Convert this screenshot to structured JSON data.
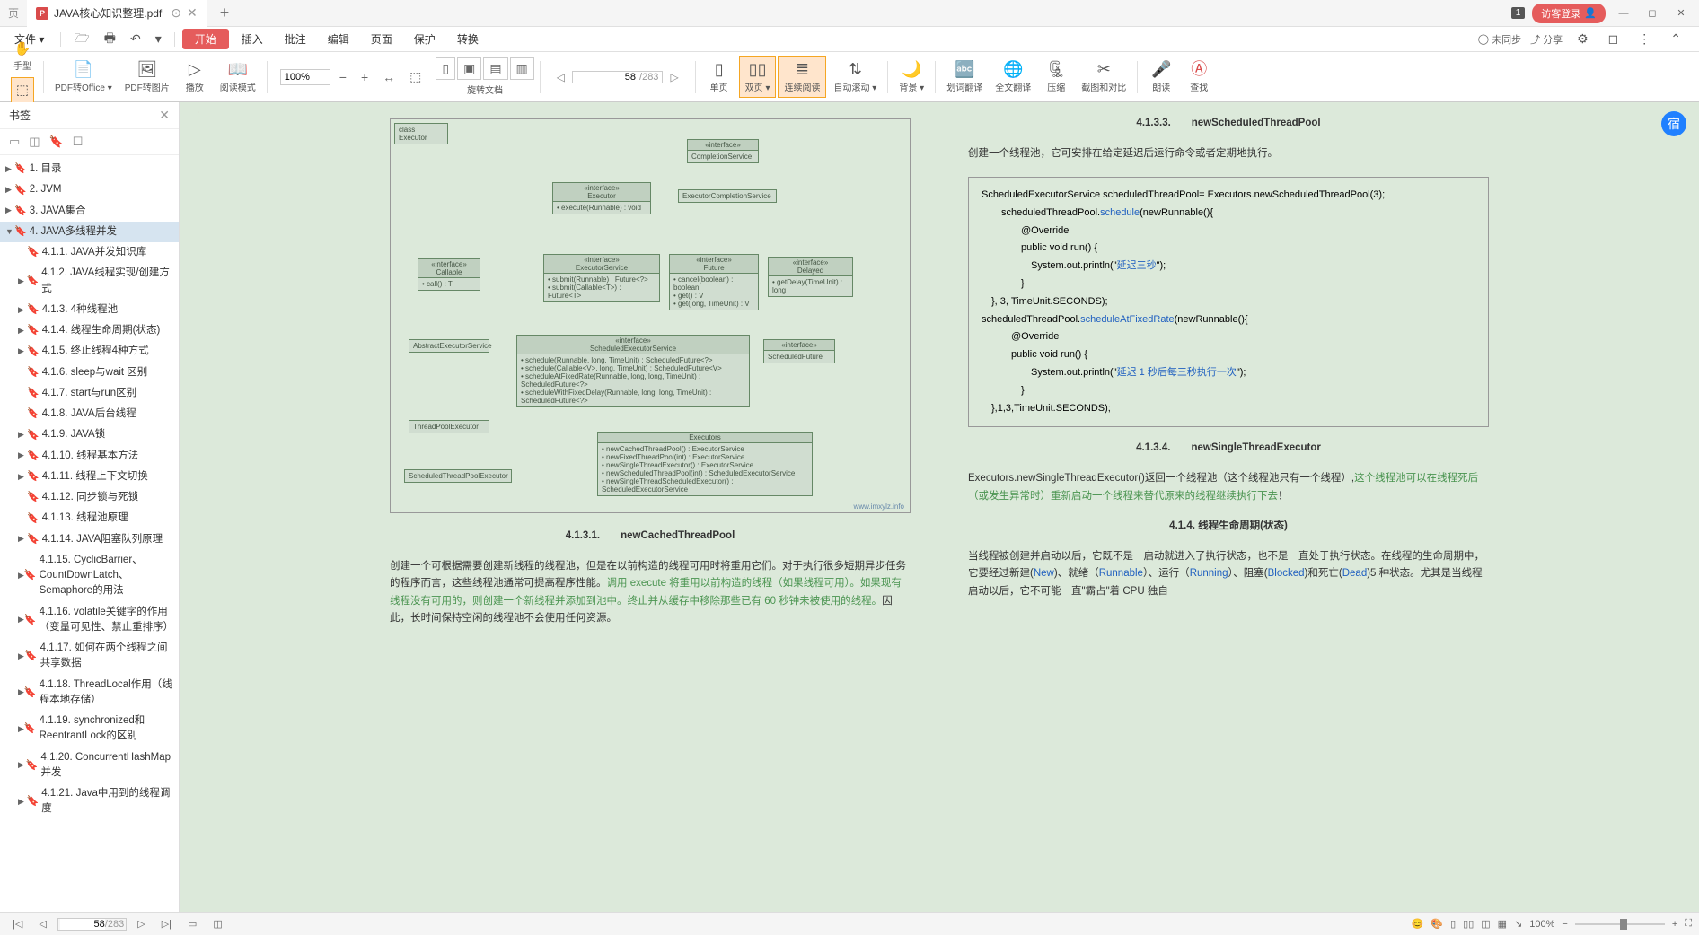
{
  "tab": {
    "icon": "P",
    "title": "JAVA核心知识整理.pdf",
    "modified": "⊙"
  },
  "titlebar": {
    "badge": "1",
    "login": "访客登录"
  },
  "menu": {
    "left_label": "页",
    "file": "文件 ▾",
    "start": "开始",
    "items": [
      "插入",
      "批注",
      "编辑",
      "页面",
      "保护",
      "转换"
    ],
    "unsync": "未同步",
    "share": "分享"
  },
  "left_tools": {
    "hand": "手型",
    "select": "选择"
  },
  "toolbar": {
    "pdf_office": "PDF转Office ▾",
    "pdf_image": "PDF转图片",
    "play": "播放",
    "read_mode": "阅读模式",
    "zoom": "100%",
    "rotate": "旋转文档",
    "page_current": "58",
    "page_total": "/283",
    "single": "单页",
    "double": "双页 ▾",
    "continuous": "连续阅读",
    "auto_scroll": "自动滚动 ▾",
    "bg": "背景 ▾",
    "translate_lookup": "划词翻译",
    "translate_full": "全文翻译",
    "compress": "压缩",
    "screenshot": "截图和对比",
    "read_aloud": "朗读",
    "find": "查找"
  },
  "bookmark": {
    "title": "书签",
    "tree": [
      {
        "level": 0,
        "expand": "▶",
        "text": "1. 目录"
      },
      {
        "level": 0,
        "expand": "▶",
        "text": "2. JVM"
      },
      {
        "level": 0,
        "expand": "▶",
        "text": "3. JAVA集合"
      },
      {
        "level": 0,
        "expand": "▼",
        "text": "4. JAVA多线程并发",
        "selected": true
      },
      {
        "level": 1,
        "expand": "",
        "text": "4.1.1. JAVA并发知识库"
      },
      {
        "level": 1,
        "expand": "▶",
        "text": "4.1.2. JAVA线程实现/创建方式"
      },
      {
        "level": 1,
        "expand": "▶",
        "text": "4.1.3. 4种线程池"
      },
      {
        "level": 1,
        "expand": "▶",
        "text": "4.1.4. 线程生命周期(状态)"
      },
      {
        "level": 1,
        "expand": "▶",
        "text": "4.1.5. 终止线程4种方式"
      },
      {
        "level": 1,
        "expand": "",
        "text": "4.1.6. sleep与wait 区别"
      },
      {
        "level": 1,
        "expand": "",
        "text": "4.1.7. start与run区别"
      },
      {
        "level": 1,
        "expand": "",
        "text": "4.1.8. JAVA后台线程"
      },
      {
        "level": 1,
        "expand": "▶",
        "text": "4.1.9. JAVA锁"
      },
      {
        "level": 1,
        "expand": "▶",
        "text": "4.1.10. 线程基本方法"
      },
      {
        "level": 1,
        "expand": "▶",
        "text": "4.1.11. 线程上下文切换"
      },
      {
        "level": 1,
        "expand": "",
        "text": "4.1.12. 同步锁与死锁"
      },
      {
        "level": 1,
        "expand": "",
        "text": "4.1.13. 线程池原理"
      },
      {
        "level": 1,
        "expand": "▶",
        "text": "4.1.14. JAVA阻塞队列原理"
      },
      {
        "level": 1,
        "expand": "▶",
        "text": "4.1.15. CyclicBarrier、CountDownLatch、Semaphore的用法"
      },
      {
        "level": 1,
        "expand": "▶",
        "text": "4.1.16. volatile关键字的作用（变量可见性、禁止重排序）"
      },
      {
        "level": 1,
        "expand": "▶",
        "text": "4.1.17. 如何在两个线程之间共享数据"
      },
      {
        "level": 1,
        "expand": "▶",
        "text": "4.1.18. ThreadLocal作用（线程本地存储）"
      },
      {
        "level": 1,
        "expand": "▶",
        "text": "4.1.19. synchronized和ReentrantLock的区别"
      },
      {
        "level": 1,
        "expand": "▶",
        "text": "4.1.20. ConcurrentHashMap并发"
      },
      {
        "level": 1,
        "expand": "▶",
        "text": "4.1.21. Java中用到的线程调度"
      }
    ]
  },
  "page_left": {
    "diagram": {
      "boxes": {
        "executor_class": "class Executor",
        "completion_svc": "«interface»\nCompletionService",
        "executor": "«interface»\nExecutor\n• execute(Runnable) : void",
        "exec_completion_svc": "ExecutorCompletionService",
        "callable": "«interface»\nCallable\n• call() : T",
        "exec_service": "«interface»\nExecutorService\n• submit(Runnable) : Future<?>\n• submit(Callable<T>) : Future<T>",
        "future": "«interface»\nFuture\n• cancel(boolean) : boolean\n• get() : V\n• get(long, TimeUnit) : V",
        "delayed": "«interface»\nDelayed\n• getDelay(TimeUnit) : long",
        "abs_exec_service": "AbstractExecutorService",
        "sched_exec_service": "«interface»\nScheduledExecutorService\n• schedule(Runnable, long, TimeUnit) : ScheduledFuture<?>\n• schedule(Callable<V>, long, TimeUnit) : ScheduledFuture<V>\n• scheduleAtFixedRate(Runnable, long, long, TimeUnit) : ScheduledFuture<?>\n• scheduleWithFixedDelay(Runnable, long, long, TimeUnit) : ScheduledFuture<?>",
        "sched_future": "«interface»\nScheduledFuture",
        "tp_executor": "ThreadPoolExecutor",
        "executors": "Executors\n• newCachedThreadPool() : ExecutorService\n• newFixedThreadPool(int) : ExecutorService\n• newSingleThreadExecutor() : ExecutorService\n• newScheduledThreadPool(int) : ScheduledExecutorService\n• newSingleThreadScheduledExecutor() : ScheduledExecutorService",
        "sched_tp_executor": "ScheduledThreadPoolExecutor"
      },
      "watermark": "www.imxylz.info"
    },
    "heading": "4.1.3.1.　　newCachedThreadPool",
    "para1": "创建一个可根据需要创建新线程的线程池，但是在以前构造的线程可用时将重用它们。对于执行很多短期异步任务的程序而言，这些线程池通常可提高程序性能。",
    "para1_green": "调用 execute 将重用以前构造的线程（如果线程可用）。如果现有线程没有可用的，则创建一个新线程并添加到池中。终止并从缓存中移除那些已有 60 秒钟未被使用的线程。",
    "para1_end": "因此，长时间保持空闲的线程池不会使用任何资源。"
  },
  "page_right": {
    "heading1": "4.1.3.3.　　newScheduledThreadPool",
    "para1": "创建一个线程池，它可安排在给定延迟后运行命令或者定期地执行。",
    "code": {
      "l1a": "ScheduledExecutorService scheduledThreadPool= Executors.newScheduledThreadPool(3);",
      "l2a": "　　scheduledThreadPool.",
      "l2b": "schedule",
      "l2c": "(newRunnable(){",
      "l3": "　　　　@Override",
      "l4": "　　　　public void run() {",
      "l5a": "　　　　　System.out.println(\"",
      "l5b": "延迟三秒",
      "l5c": "\");",
      "l6": "　　　　}",
      "l7": "　}, 3, TimeUnit.SECONDS);",
      "l8a": "scheduledThreadPool.",
      "l8b": "scheduleAtFixedRate",
      "l8c": "(newRunnable(){",
      "l9": "　　　@Override",
      "l10": "　　　public void run() {",
      "l11a": "　　　　　System.out.println(\"",
      "l11b": "延迟 1 秒后每三秒执行一次",
      "l11c": "\");",
      "l12": "　　　　}",
      "l13": "　},1,3,TimeUnit.SECONDS);"
    },
    "heading2": "4.1.3.4.　　newSingleThreadExecutor",
    "para2a": "Executors.newSingleThreadExecutor()返回一个线程池（这个线程池只有一个线程）,",
    "para2b": "这个线程池可以在线程死后（或发生异常时）重新启动一个线程来替代原来的线程继续执行下去",
    "para2c": "！",
    "heading3": "4.1.4. 线程生命周期(状态)",
    "para3a": "当线程被创建并启动以后，它既不是一启动就进入了执行状态，也不是一直处于执行状态。在线程的生命周期中，它要经过新建(",
    "para3_new": "New",
    "para3b": ")、就绪（",
    "para3_run": "Runnable",
    "para3c": "）、运行（",
    "para3_running": "Running",
    "para3d": "）、阻塞(",
    "para3_block": "Blocked",
    "para3e": ")和死亡(",
    "para3_dead": "Dead",
    "para3f": ")5 种状态。尤其是当线程启动以后，它不可能一直\"霸占\"着 CPU 独自"
  },
  "statusbar": {
    "page_current": "58",
    "page_total": "/283",
    "zoom": "100%"
  },
  "float_badge": "宿"
}
